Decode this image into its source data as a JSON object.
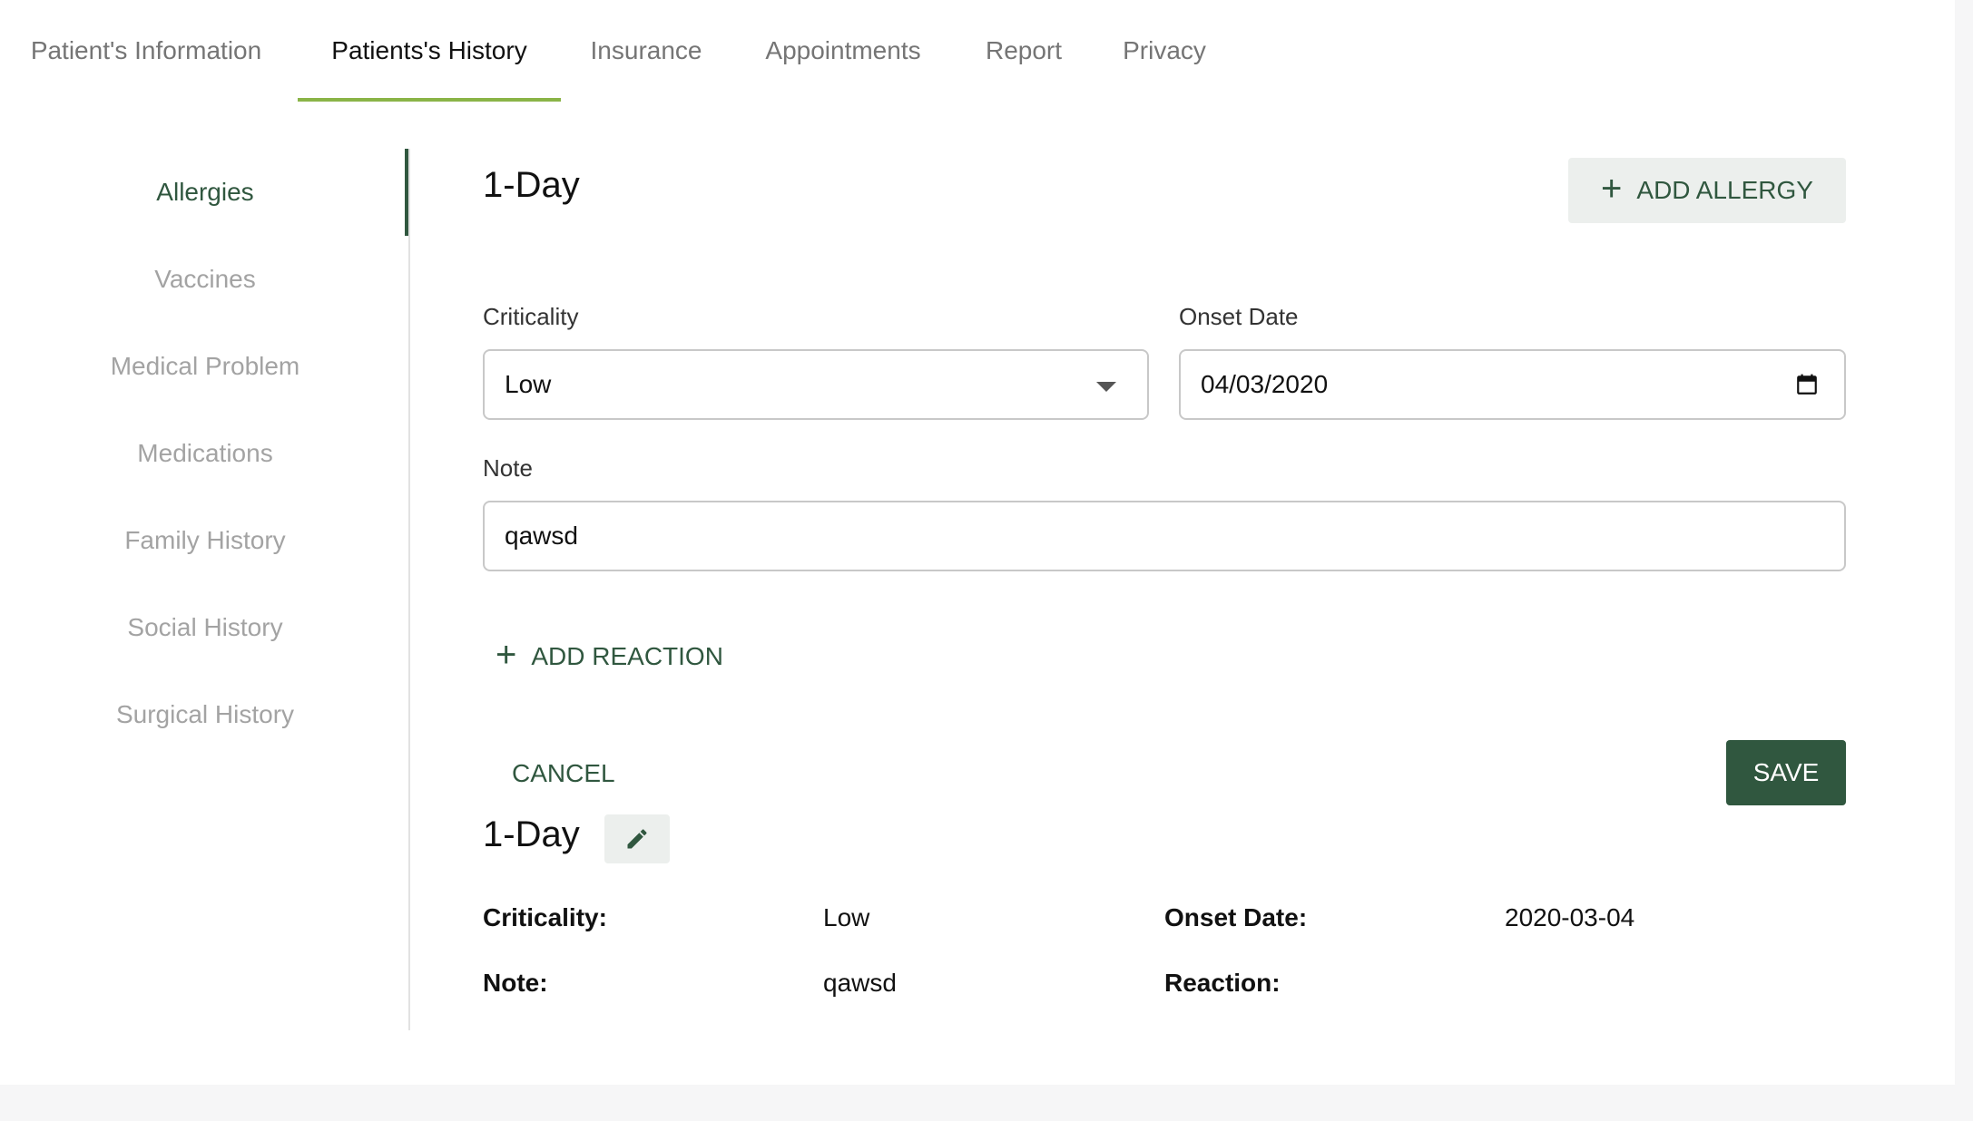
{
  "tabs": [
    {
      "label": "Patient's Information"
    },
    {
      "label": "Patients's History"
    },
    {
      "label": "Insurance"
    },
    {
      "label": "Appointments"
    },
    {
      "label": "Report"
    },
    {
      "label": "Privacy"
    }
  ],
  "active_tab": "Patients's History",
  "sidebar": {
    "items": [
      {
        "label": "Allergies"
      },
      {
        "label": "Vaccines"
      },
      {
        "label": "Medical Problem"
      },
      {
        "label": "Medications"
      },
      {
        "label": "Family History"
      },
      {
        "label": "Social History"
      },
      {
        "label": "Surgical History"
      }
    ],
    "active": "Allergies"
  },
  "form": {
    "title": "1-Day",
    "add_allergy_label": "ADD ALLERGY",
    "criticality_label": "Criticality",
    "criticality_value": "Low",
    "onset_label": "Onset Date",
    "onset_value": "04/03/2020",
    "note_label": "Note",
    "note_value": "qawsd",
    "add_reaction_label": "ADD REACTION",
    "cancel_label": "CANCEL",
    "save_label": "SAVE"
  },
  "summary": {
    "title": "1-Day",
    "criticality_label": "Criticality:",
    "criticality_value": "Low",
    "onset_label": "Onset Date:",
    "onset_value": "2020-03-04",
    "note_label": "Note:",
    "note_value": "qawsd",
    "reaction_label": "Reaction:"
  },
  "colors": {
    "accent_green": "#30573f",
    "tab_underline": "#8ab447"
  },
  "icons": [
    "plus-icon",
    "dropdown-caret-icon",
    "calendar-icon",
    "pencil-icon"
  ]
}
